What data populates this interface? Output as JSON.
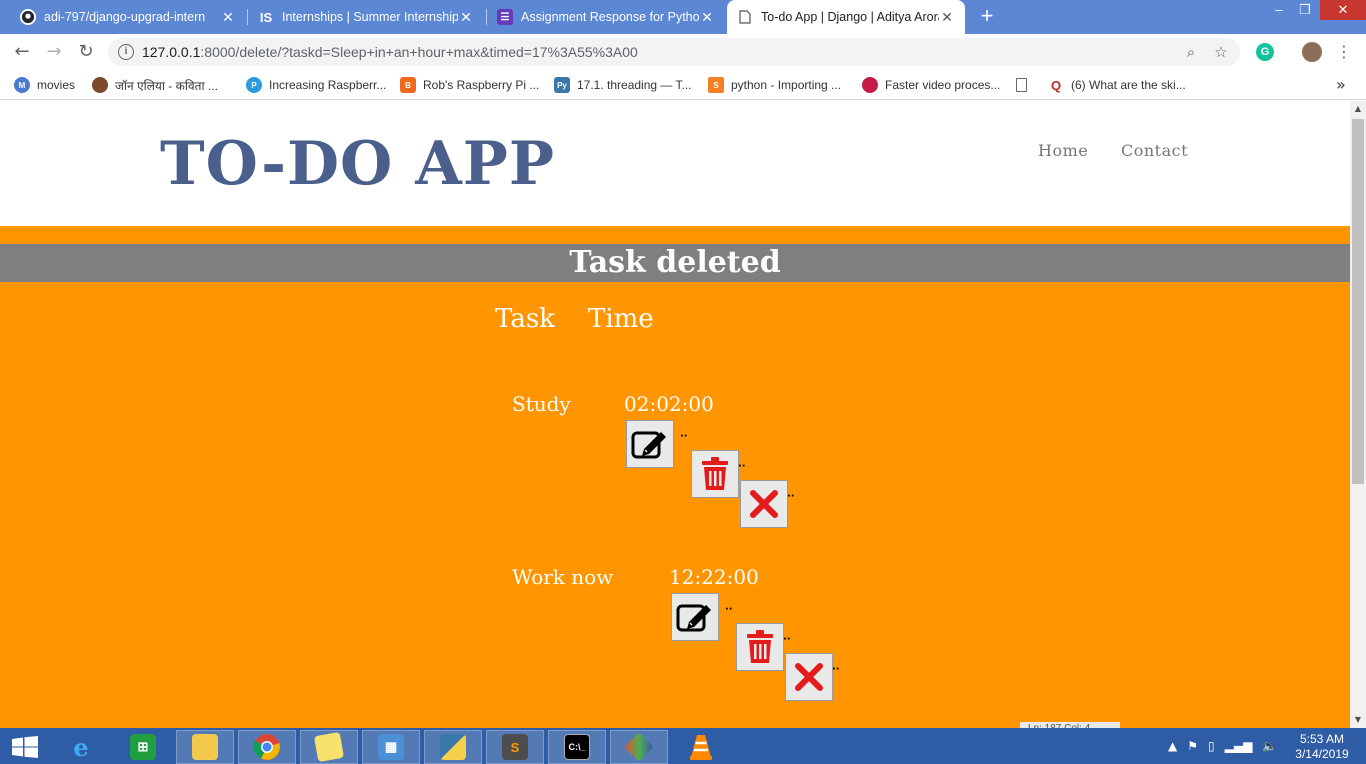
{
  "browser": {
    "tabs": [
      {
        "title": "adi-797/django-upgrad-intern",
        "icon": "github-icon"
      },
      {
        "title": "Internships | Summer Internship",
        "icon": "internshala-icon"
      },
      {
        "title": "Assignment Response for Python",
        "icon": "forms-icon"
      },
      {
        "title": "To-do App | Django | Aditya Arora",
        "icon": "page-icon"
      }
    ],
    "url_host": "127.0.0.1",
    "url_rest": ":8000/delete/?taskd=Sleep+in+an+hour+max&timed=17%3A55%3A00",
    "bookmarks": [
      {
        "label": "movies",
        "icon": "movies-icon",
        "color": "#4a7bd0"
      },
      {
        "label": "जॉन एलिया - कविता ...",
        "icon": "rekhta-icon",
        "color": "#7a4a2a"
      },
      {
        "label": "Increasing Raspberr...",
        "icon": "p-icon",
        "color": "#2a9de0"
      },
      {
        "label": "Rob's Raspberry Pi ...",
        "icon": "blogger-icon",
        "color": "#f06a1c"
      },
      {
        "label": "17.1. threading — T...",
        "icon": "python-icon",
        "color": "#3b77a8"
      },
      {
        "label": "python - Importing ...",
        "icon": "stackoverflow-icon",
        "color": "#f48024"
      },
      {
        "label": "Faster video proces...",
        "icon": "raspberry-icon",
        "color": "#c51a4a"
      },
      {
        "label": "",
        "icon": "document-icon",
        "color": "#666666"
      },
      {
        "label": "(6) What are the ski...",
        "icon": "quora-icon",
        "color": "#b92b27"
      }
    ]
  },
  "site": {
    "title": "TO-DO APP",
    "nav": {
      "home": "Home",
      "contact": "Contact"
    },
    "banner": "Task deleted",
    "table": {
      "headers": {
        "task": "Task",
        "time": "Time"
      },
      "rows": [
        {
          "task": "Study",
          "time": "02:02:00"
        },
        {
          "task": "Work now",
          "time": "12:22:00"
        }
      ]
    },
    "colors": {
      "title": "#4a5f8c",
      "main_bg": "#ff9500",
      "banner_bg": "#7f7f7f"
    }
  },
  "taskbar": {
    "apps": [
      "start-icon",
      "internet-explorer-icon",
      "store-icon",
      "file-explorer-icon",
      "chrome-icon",
      "sticky-notes-icon",
      "control-panel-icon",
      "python-icon",
      "sublime-text-icon",
      "cmd-icon",
      "git-icon",
      "vlc-icon"
    ],
    "time": "5:53 AM",
    "date": "3/14/2019",
    "status_fragment": "Ln: 187   Col: 4"
  }
}
